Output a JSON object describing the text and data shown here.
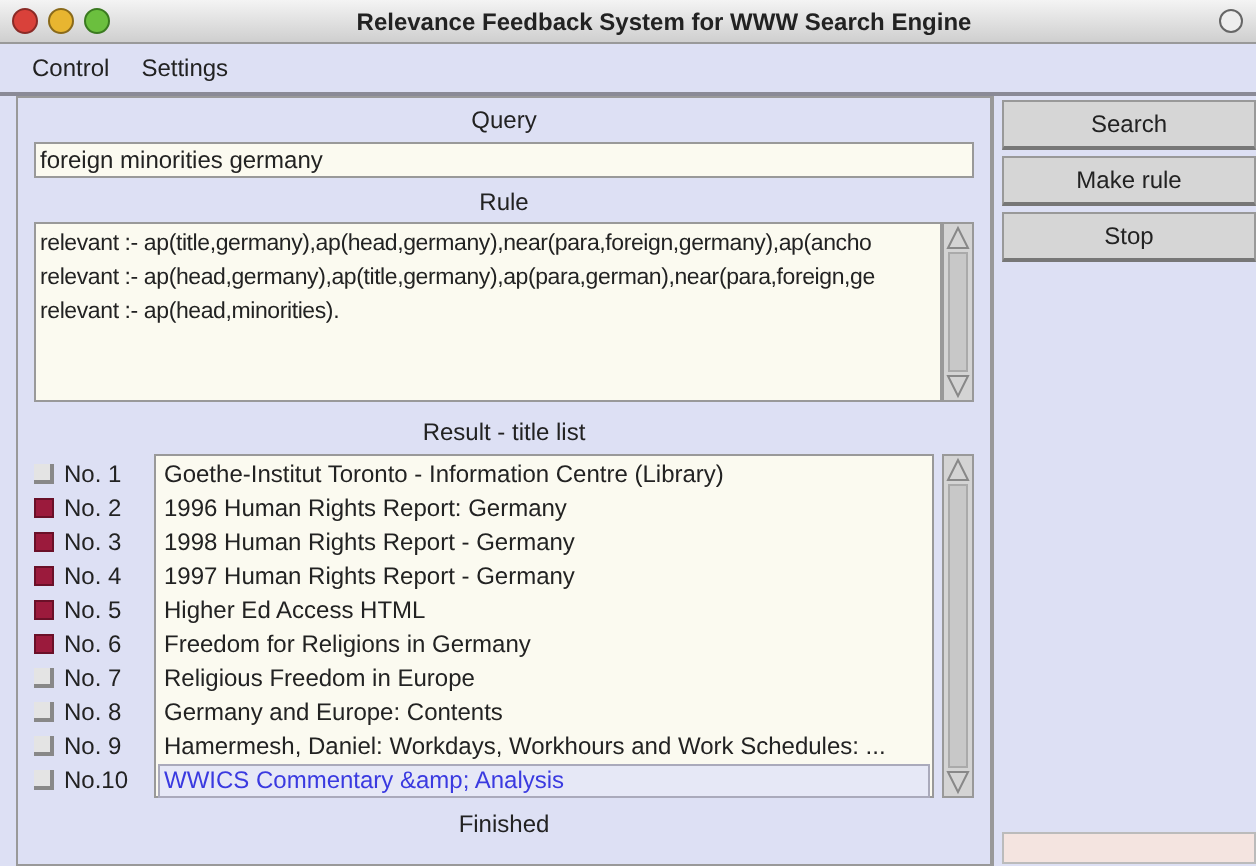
{
  "window": {
    "title": "Relevance Feedback System for WWW Search Engine"
  },
  "menu": [
    "Control",
    "Settings"
  ],
  "query": {
    "label": "Query",
    "value": "foreign minorities germany"
  },
  "rule": {
    "label": "Rule",
    "lines": [
      "relevant :-  ap(title,germany),ap(head,germany),near(para,foreign,germany),ap(ancho",
      "relevant :-  ap(head,germany),ap(title,germany),ap(para,german),near(para,foreign,ge",
      "relevant :-  ap(head,minorities)."
    ]
  },
  "result": {
    "label": "Result - title list",
    "rows": [
      {
        "number": "No. 1",
        "checked": false,
        "title": "Goethe-Institut Toronto - Information Centre (Library)",
        "selected": false
      },
      {
        "number": "No. 2",
        "checked": true,
        "title": "1996 Human Rights Report: Germany",
        "selected": false
      },
      {
        "number": "No. 3",
        "checked": true,
        "title": "1998 Human Rights Report - Germany",
        "selected": false
      },
      {
        "number": "No. 4",
        "checked": true,
        "title": "1997 Human Rights Report - Germany",
        "selected": false
      },
      {
        "number": "No. 5",
        "checked": true,
        "title": "Higher Ed Access HTML",
        "selected": false
      },
      {
        "number": "No. 6",
        "checked": true,
        "title": "Freedom for Religions in Germany",
        "selected": false
      },
      {
        "number": "No. 7",
        "checked": false,
        "title": "Religious Freedom in Europe",
        "selected": false
      },
      {
        "number": "No. 8",
        "checked": false,
        "title": "Germany and Europe: Contents",
        "selected": false
      },
      {
        "number": "No. 9",
        "checked": false,
        "title": "Hamermesh, Daniel: Workdays, Workhours and Work Schedules: ...",
        "selected": false
      },
      {
        "number": "No.10",
        "checked": false,
        "title": "WWICS Commentary &amp; Analysis",
        "selected": true
      }
    ]
  },
  "status": "Finished",
  "buttons": [
    "Search",
    "Make rule",
    "Stop"
  ]
}
